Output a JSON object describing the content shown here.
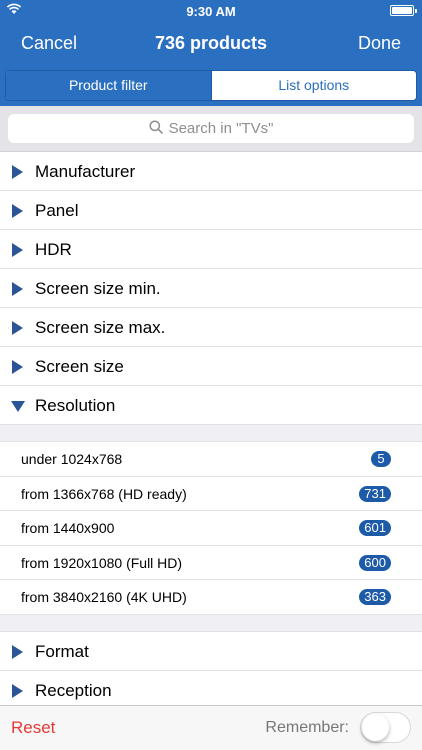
{
  "status": {
    "time": "9:30 AM"
  },
  "nav": {
    "cancel_label": "Cancel",
    "title": "736 products",
    "done_label": "Done"
  },
  "segments": [
    {
      "label": "Product filter",
      "selected": true
    },
    {
      "label": "List options",
      "selected": false
    }
  ],
  "search": {
    "placeholder": "Search in \"TVs\"",
    "icon": "search-icon"
  },
  "filters": [
    {
      "label": "Manufacturer",
      "expanded": false
    },
    {
      "label": "Panel",
      "expanded": false
    },
    {
      "label": "HDR",
      "expanded": false
    },
    {
      "label": "Screen size min.",
      "expanded": false
    },
    {
      "label": "Screen size max.",
      "expanded": false
    },
    {
      "label": "Screen size",
      "expanded": false
    },
    {
      "label": "Resolution",
      "expanded": true
    },
    {
      "label": "Format",
      "expanded": false
    },
    {
      "label": "Reception",
      "expanded": false
    }
  ],
  "resolution_options": [
    {
      "label": "under 1024x768",
      "count": "5"
    },
    {
      "label": "from 1366x768 (HD ready)",
      "count": "731"
    },
    {
      "label": "from 1440x900",
      "count": "601"
    },
    {
      "label": "from 1920x1080 (Full HD)",
      "count": "600"
    },
    {
      "label": "from 3840x2160 (4K UHD)",
      "count": "363"
    }
  ],
  "bottom": {
    "reset_label": "Reset",
    "remember_label": "Remember:",
    "remember_on": false
  },
  "colors": {
    "accent": "#2b6fc0",
    "badge": "#1d5aa8",
    "reset": "#e53935",
    "triangle": "#2b5597"
  }
}
